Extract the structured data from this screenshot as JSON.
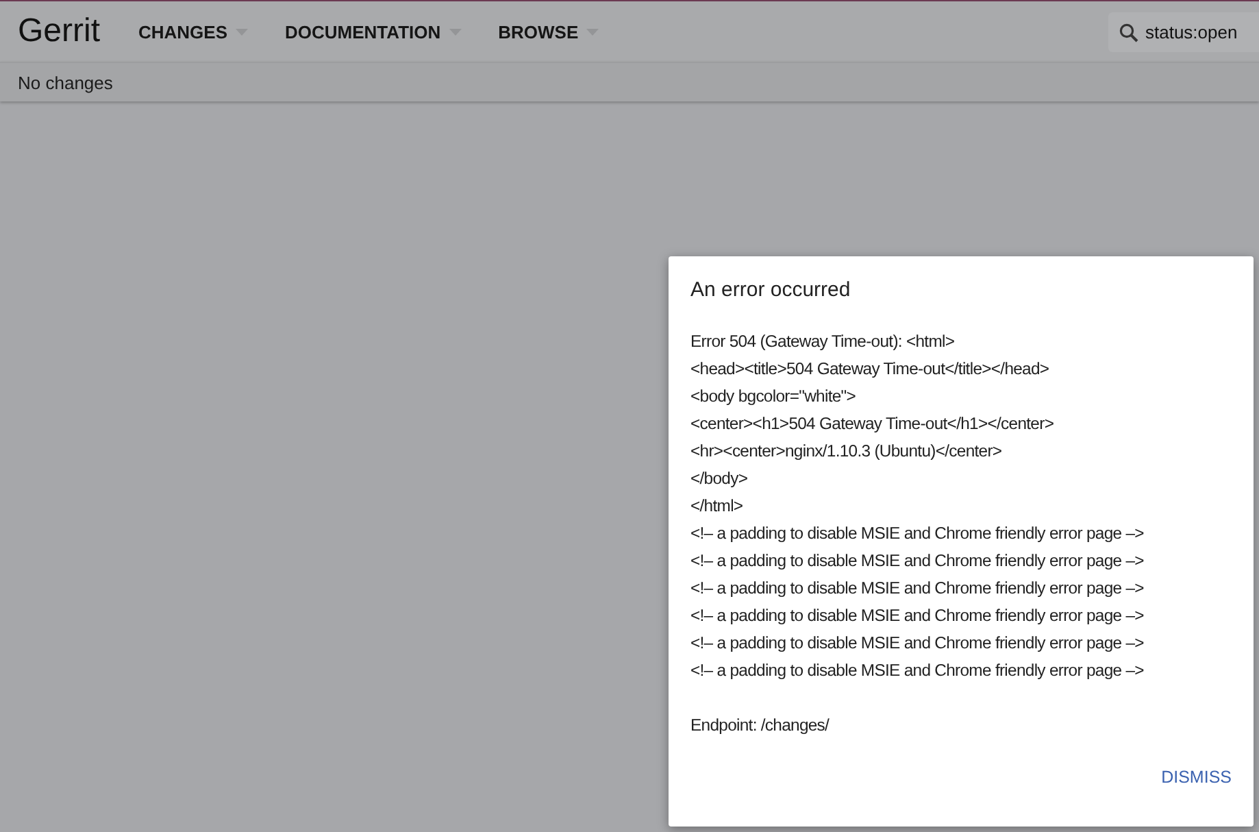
{
  "header": {
    "logo": "Gerrit",
    "menus": [
      {
        "label": "CHANGES"
      },
      {
        "label": "DOCUMENTATION"
      },
      {
        "label": "BROWSE"
      }
    ],
    "search": {
      "value": "status:open"
    }
  },
  "subheader": {
    "text": "No changes"
  },
  "dialog": {
    "title": "An error occurred",
    "message_lines": [
      "Error 504 (Gateway Time-out): <html>",
      "<head><title>504 Gateway Time-out</title></head>",
      "<body bgcolor=\"white\">",
      "<center><h1>504 Gateway Time-out</h1></center>",
      "<hr><center>nginx/1.10.3 (Ubuntu)</center>",
      "</body>",
      "</html>",
      "<!– a padding to disable MSIE and Chrome friendly error page –>",
      "<!– a padding to disable MSIE and Chrome friendly error page –>",
      "<!– a padding to disable MSIE and Chrome friendly error page –>",
      "<!– a padding to disable MSIE and Chrome friendly error page –>",
      "<!– a padding to disable MSIE and Chrome friendly error page –>",
      "<!– a padding to disable MSIE and Chrome friendly error page –>"
    ],
    "endpoint": "Endpoint: /changes/",
    "button": "DISMISS"
  }
}
